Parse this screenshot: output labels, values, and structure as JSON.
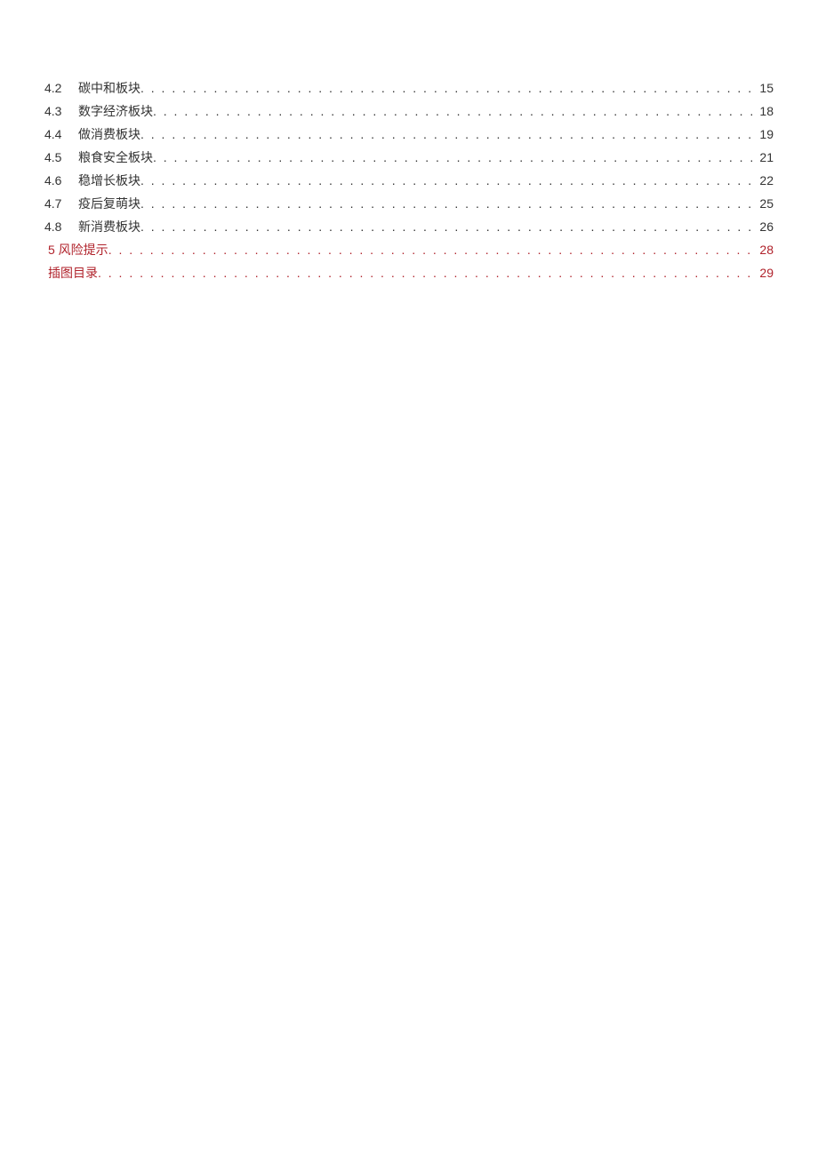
{
  "colors": {
    "accent": "#b0222b",
    "text": "#333333"
  },
  "toc": {
    "sub_entries": [
      {
        "num": "4.2",
        "title": "碳中和板块",
        "page": "15"
      },
      {
        "num": "4.3",
        "title": "数字经济板块",
        "page": "18"
      },
      {
        "num": "4.4",
        "title": "做消费板块",
        "page": "19"
      },
      {
        "num": "4.5",
        "title": "粮食安全板块",
        "page": "21"
      },
      {
        "num": "4.6",
        "title": "稳增长板块",
        "page": "22"
      },
      {
        "num": "4.7",
        "title": "疫后复萌块",
        "page": "25"
      },
      {
        "num": "4.8",
        "title": "新消费板块",
        "page": "26"
      }
    ],
    "top_entries": [
      {
        "title": "5 风险提示",
        "page": "28"
      },
      {
        "title": "插图目录",
        "page": "29"
      }
    ]
  }
}
